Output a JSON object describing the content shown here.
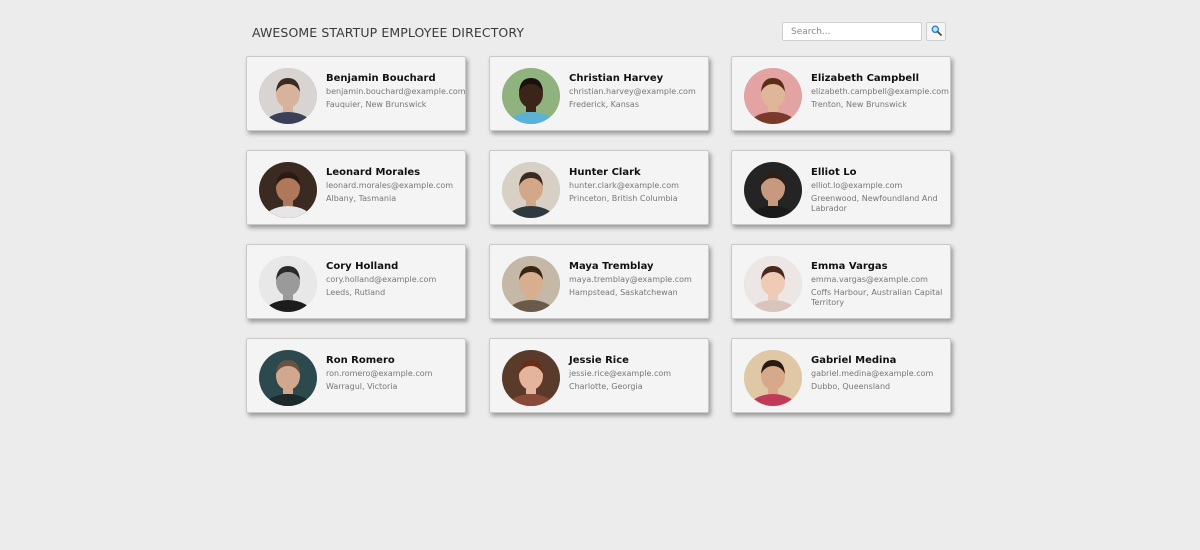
{
  "header": {
    "title": "AWESOME STARTUP EMPLOYEE DIRECTORY",
    "search_placeholder": "Search...",
    "search_icon": "magnifier-icon"
  },
  "colors": {
    "background": "#ececec",
    "card": "#f4f4f4"
  },
  "employees": [
    {
      "name": "Benjamin Bouchard",
      "email": "benjamin.bouchard@example.com",
      "location": "Fauquier, New Brunswick",
      "bg": "#d9d4d2",
      "skin": "#d8b39c",
      "hair": "#3a2a22",
      "shirt": "#3b3f57"
    },
    {
      "name": "Christian Harvey",
      "email": "christian.harvey@example.com",
      "location": "Frederick, Kansas",
      "bg": "#8fb27f",
      "skin": "#3b2418",
      "hair": "#1a110c",
      "shirt": "#5ab3d6"
    },
    {
      "name": "Elizabeth Campbell",
      "email": "elizabeth.campbell@example.com",
      "location": "Trenton, New Brunswick",
      "bg": "#e3a3a3",
      "skin": "#e0b69a",
      "hair": "#5a2e16",
      "shirt": "#7a3a2a"
    },
    {
      "name": "Leonard Morales",
      "email": "leonard.morales@example.com",
      "location": "Albany, Tasmania",
      "bg": "#3a2a22",
      "skin": "#b0785a",
      "hair": "#2a1a12",
      "shirt": "#e6e6e6"
    },
    {
      "name": "Hunter Clark",
      "email": "hunter.clark@example.com",
      "location": "Princeton, British Columbia",
      "bg": "#d8d0c4",
      "skin": "#d3a889",
      "hair": "#3a2a20",
      "shirt": "#2f3a40"
    },
    {
      "name": "Elliot Lo",
      "email": "elliot.lo@example.com",
      "location": "Greenwood, Newfoundland And Labrador",
      "bg": "#242424",
      "skin": "#c79a80",
      "hair": "#2e2016",
      "shirt": "#1a1a1a"
    },
    {
      "name": "Cory Holland",
      "email": "cory.holland@example.com",
      "location": "Leeds, Rutland",
      "bg": "#e8e8e8",
      "skin": "#9a9a9a",
      "hair": "#2a2a2a",
      "shirt": "#1c1c1c"
    },
    {
      "name": "Maya Tremblay",
      "email": "maya.tremblay@example.com",
      "location": "Hampstead, Saskatchewan",
      "bg": "#c6b8a6",
      "skin": "#d7ae8e",
      "hair": "#3a2414",
      "shirt": "#6a5a4a"
    },
    {
      "name": "Emma Vargas",
      "email": "emma.vargas@example.com",
      "location": "Coffs Harbour, Australian Capital Territory",
      "bg": "#ece6e4",
      "skin": "#efcbb6",
      "hair": "#4a2a1c",
      "shirt": "#d9c4bc"
    },
    {
      "name": "Ron Romero",
      "email": "ron.romero@example.com",
      "location": "Warragul, Victoria",
      "bg": "#2c4a4e",
      "skin": "#d1a88e",
      "hair": "#6a5240",
      "shirt": "#1c2a2c"
    },
    {
      "name": "Jessie Rice",
      "email": "jessie.rice@example.com",
      "location": "Charlotte, Georgia",
      "bg": "#5a3a2a",
      "skin": "#e4b59a",
      "hair": "#6a2e18",
      "shirt": "#8a4a3a"
    },
    {
      "name": "Gabriel Medina",
      "email": "gabriel.medina@example.com",
      "location": "Dubbo, Queensland",
      "bg": "#e0c8a6",
      "skin": "#d8a88a",
      "hair": "#2a1a12",
      "shirt": "#c23a5a"
    }
  ]
}
